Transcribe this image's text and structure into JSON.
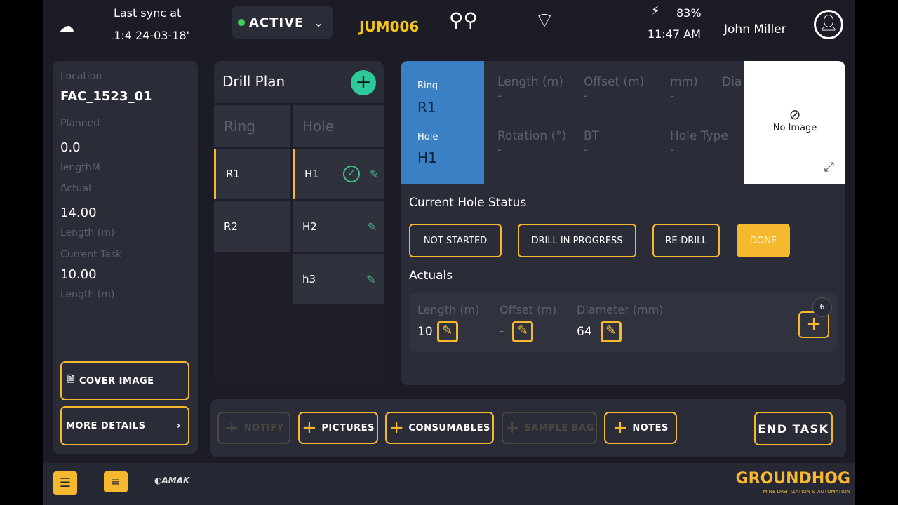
{
  "header": {
    "sync_label": "Last sync at",
    "sync_time": "'24-03-18 11:4",
    "status": "ACTIVE",
    "status_color": "#3fcf5a",
    "machine": "JUM006",
    "battery": "83%",
    "time": "11:47 AM",
    "user": "John Miller"
  },
  "left": {
    "location_label": "Location",
    "location": "FAC_1523_01",
    "planned_label": "Planned",
    "planned": "0.0",
    "planned_unit": "lengthM",
    "actual_label": "Actual",
    "actual": "14.00",
    "actual_unit": "Length (m)",
    "task_label": "Current Task",
    "task": "10.00",
    "task_unit": "Length (m)",
    "cover_image": "COVER IMAGE",
    "more_details": "MORE DETAILS"
  },
  "drill_plan": {
    "title": "Drill Plan",
    "ring_header": "Ring",
    "hole_header": "Hole",
    "rings": [
      "R1",
      "R2"
    ],
    "holes": [
      {
        "name": "H1",
        "done": true
      },
      {
        "name": "H2",
        "done": false
      },
      {
        "name": "h3",
        "done": false
      }
    ]
  },
  "detail": {
    "ring_label": "Ring",
    "ring": "R1",
    "hole_label": "Hole",
    "hole": "H1",
    "fields": [
      {
        "label": "Length (m)",
        "value": "-"
      },
      {
        "label": "Offset (m)",
        "value": "-"
      },
      {
        "label": "mm)",
        "value": "-"
      },
      {
        "label": "Dia",
        "value": ""
      },
      {
        "label": "Rotation (°)",
        "value": "-"
      },
      {
        "label": "BT",
        "value": "-"
      },
      {
        "label": "Hole Type",
        "value": "-"
      }
    ],
    "no_image": "No Image"
  },
  "status": {
    "title": "Current Hole Status",
    "buttons": [
      "NOT STARTED",
      "DRILL IN PROGRESS",
      "RE-DRILL",
      "DONE"
    ],
    "active": "DONE"
  },
  "actuals": {
    "title": "Actuals",
    "length_label": "Length (m)",
    "length": "10",
    "offset_label": "Offset (m)",
    "offset": "-",
    "diameter_label": "Diameter (mm)",
    "diameter": "64",
    "badge": "6"
  },
  "actions": {
    "notify": "NOTIFY",
    "pictures": "PICTURES",
    "consumables": "CONSUMABLES",
    "sample_bag": "SAMPLE BAG",
    "notes": "NOTES",
    "end_task": "END TASK"
  },
  "footer": {
    "partner_logo": "AMAK",
    "brand": "GROUNDHOG",
    "tagline": "MINE DIGITIZATION & AUTOMATION"
  },
  "colors": {
    "accent": "#f5b82e",
    "ring_card": "#3b7fc4",
    "check": "#3fbf7f"
  }
}
